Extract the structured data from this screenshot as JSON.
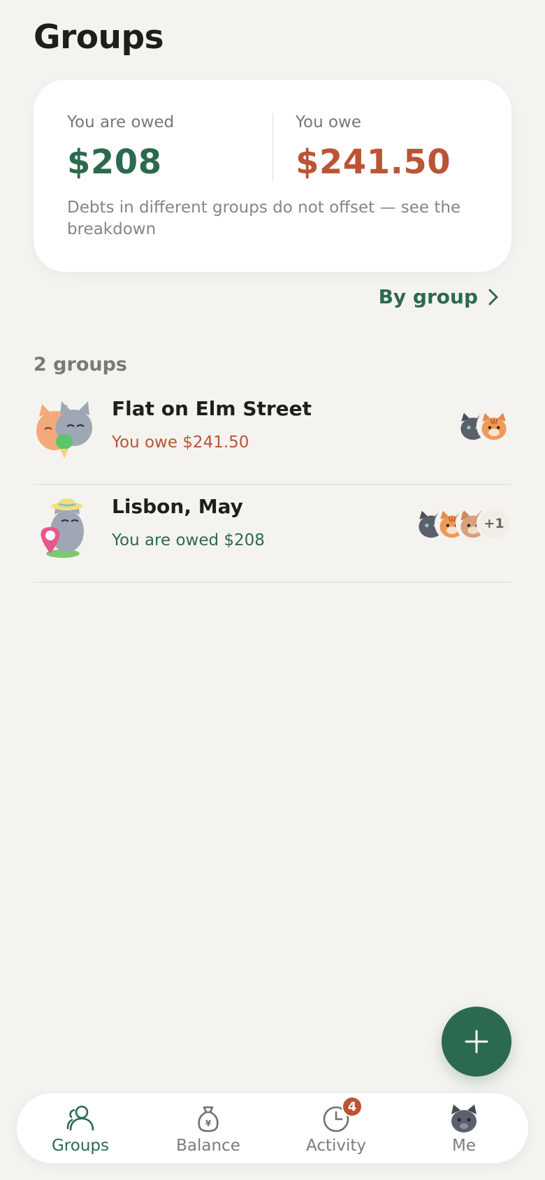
{
  "header": {
    "title": "Groups"
  },
  "summary": {
    "owed_label": "You are owed",
    "owed_amount": "$208",
    "owe_label": "You owe",
    "owe_amount": "$241.50",
    "note": "Debts in different groups do not offset — see the breakdown"
  },
  "by_group": {
    "label": "By group"
  },
  "groups_count": "2 groups",
  "groups": [
    {
      "name": "Flat on Elm Street",
      "status": "You owe $241.50",
      "status_type": "owe",
      "member_avatars": [
        "gray-cat",
        "orange-tabby-cat"
      ]
    },
    {
      "name": "Lisbon, May",
      "status": "You are owed $208",
      "status_type": "owed",
      "member_avatars": [
        "gray-cat",
        "orange-tabby-cat",
        "ginger-cat"
      ],
      "more_members": "+1"
    }
  ],
  "fab": {
    "icon": "plus-icon"
  },
  "nav": {
    "items": [
      {
        "label": "Groups",
        "icon": "people-icon",
        "active": true
      },
      {
        "label": "Balance",
        "icon": "money-bag-icon"
      },
      {
        "label": "Activity",
        "icon": "clock-icon",
        "badge": "4"
      },
      {
        "label": "Me",
        "icon": "cat-avatar-icon"
      }
    ]
  },
  "colors": {
    "background": "#f5f3f0",
    "accent_green": "#2b6a4f",
    "accent_red": "#bb5435",
    "card": "#ffffff"
  }
}
